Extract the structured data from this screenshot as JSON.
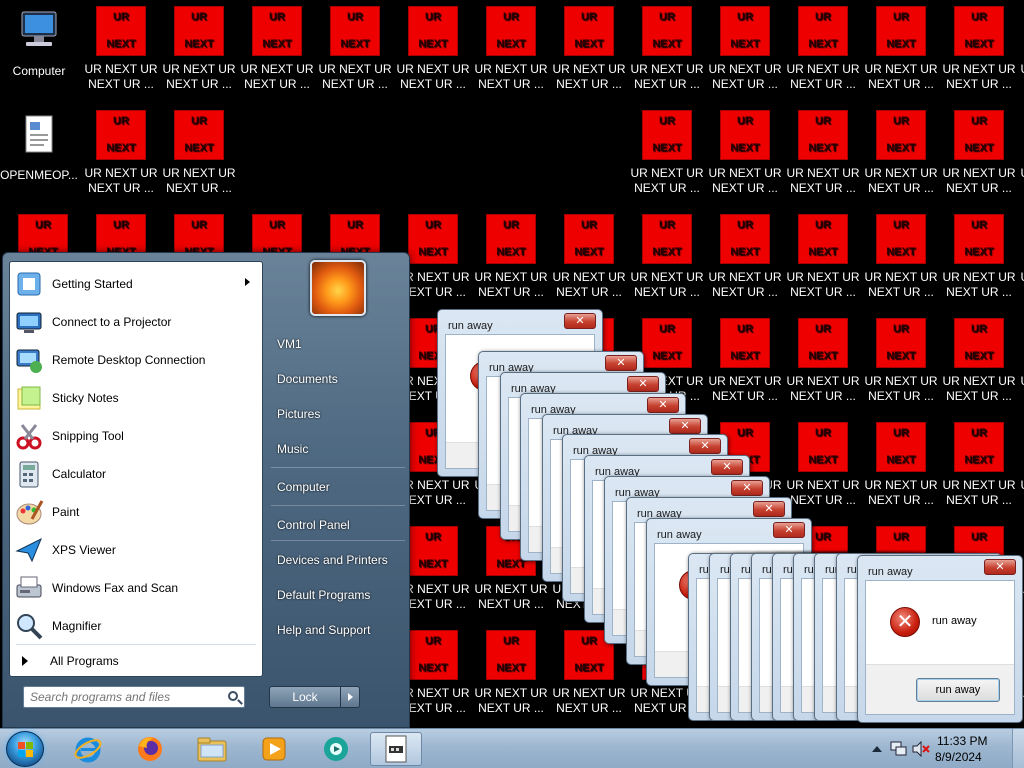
{
  "desktop": {
    "computer_label": "Computer",
    "openme_label": "OPENMEOP...",
    "ur_icon_top": "UR",
    "ur_icon_bottom": "NEXT",
    "ur_label_line1": "UR NEXT UR",
    "ur_label_line2": "NEXT UR ..."
  },
  "start_menu": {
    "programs": [
      {
        "label": "Getting Started",
        "icon": "getting-started-icon",
        "has_submenu": true
      },
      {
        "label": "Connect to a Projector",
        "icon": "projector-icon"
      },
      {
        "label": "Remote Desktop Connection",
        "icon": "remote-desktop-icon"
      },
      {
        "label": "Sticky Notes",
        "icon": "sticky-notes-icon"
      },
      {
        "label": "Snipping Tool",
        "icon": "snipping-tool-icon"
      },
      {
        "label": "Calculator",
        "icon": "calculator-icon"
      },
      {
        "label": "Paint",
        "icon": "paint-icon"
      },
      {
        "label": "XPS Viewer",
        "icon": "xps-viewer-icon"
      },
      {
        "label": "Windows Fax and Scan",
        "icon": "fax-scan-icon"
      },
      {
        "label": "Magnifier",
        "icon": "magnifier-icon"
      }
    ],
    "all_programs": "All Programs",
    "search_placeholder": "Search programs and files",
    "right_items": [
      "VM1",
      "Documents",
      "Pictures",
      "Music",
      "Computer",
      "Control Panel",
      "Devices and Printers",
      "Default Programs",
      "Help and Support"
    ],
    "lock_label": "Lock"
  },
  "dialog": {
    "title": "run away",
    "message": "run away",
    "button": "run away",
    "close": "✕"
  },
  "taskbar": {
    "time": "11:33 PM",
    "date": "8/9/2024"
  }
}
